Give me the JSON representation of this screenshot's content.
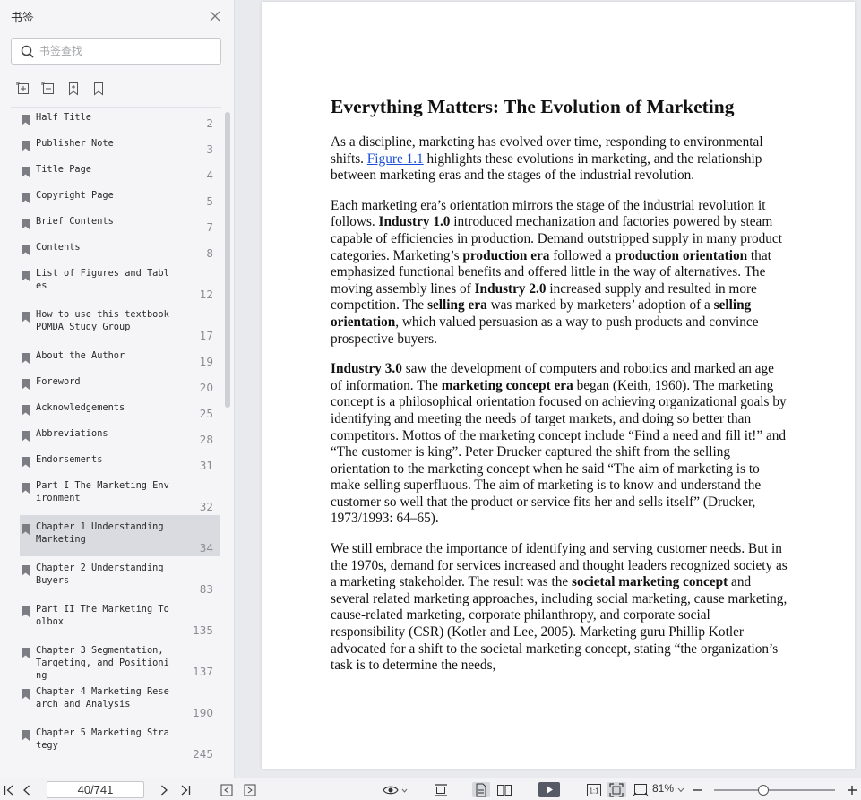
{
  "sidebar": {
    "title": "书签",
    "search_placeholder": "书签查找",
    "bookmarks": [
      {
        "label": "Half Title",
        "page": "2"
      },
      {
        "label": "Publisher Note",
        "page": "3"
      },
      {
        "label": "Title Page",
        "page": "4"
      },
      {
        "label": "Copyright Page",
        "page": "5"
      },
      {
        "label": "Brief Contents",
        "page": "7"
      },
      {
        "label": "Contents",
        "page": "8"
      },
      {
        "label": "List of Figures and Tables",
        "page": "12"
      },
      {
        "label": "How to use this textbook POMDA Study Group",
        "page": "17"
      },
      {
        "label": "About the Author",
        "page": "19"
      },
      {
        "label": "Foreword",
        "page": "20"
      },
      {
        "label": "Acknowledgements",
        "page": "25"
      },
      {
        "label": "Abbreviations",
        "page": "28"
      },
      {
        "label": "Endorsements",
        "page": "31"
      },
      {
        "label": "Part I The Marketing Environment",
        "page": "32"
      },
      {
        "label": "Chapter 1 Understanding Marketing",
        "page": "34",
        "selected": true
      },
      {
        "label": "Chapter 2 Understanding Buyers",
        "page": "83"
      },
      {
        "label": "Part II The Marketing Toolbox",
        "page": "135"
      },
      {
        "label": "Chapter 3 Segmentation, Targeting, and Positioning",
        "page": "137"
      },
      {
        "label": "Chapter 4 Marketing Research and Analysis",
        "page": "190"
      },
      {
        "label": "Chapter 5 Marketing Strategy",
        "page": "245"
      }
    ]
  },
  "document": {
    "heading": "Everything Matters: The Evolution of Marketing",
    "paragraphs": [
      [
        {
          "t": "As a discipline, marketing has evolved over time, responding to environmental shifts. "
        },
        {
          "t": "Figure 1.1",
          "link": true
        },
        {
          "t": " highlights these evolutions in marketing, and the relationship between marketing eras and the stages of the industrial revolution."
        }
      ],
      [
        {
          "t": "Each marketing era’s orientation mirrors the stage of the industrial revolution it follows. "
        },
        {
          "t": "Industry 1.0",
          "b": true
        },
        {
          "t": " introduced mechanization and factories powered by steam capable of efficiencies in production. Demand outstripped supply in many product categories. Marketing’s "
        },
        {
          "t": "production era",
          "b": true
        },
        {
          "t": " followed a "
        },
        {
          "t": "production orientation",
          "b": true
        },
        {
          "t": " that emphasized functional benefits and offered little in the way of alternatives. The moving assembly lines of "
        },
        {
          "t": "Industry 2.0",
          "b": true
        },
        {
          "t": " increased supply and resulted in more competition. The "
        },
        {
          "t": "selling era",
          "b": true
        },
        {
          "t": " was marked by marketers’ adoption of a "
        },
        {
          "t": "selling orientation",
          "b": true
        },
        {
          "t": ", which valued persuasion as a way to push products and convince prospective buyers."
        }
      ],
      [
        {
          "t": "Industry 3.0",
          "b": true
        },
        {
          "t": " saw the development of computers and robotics and marked an age of information. The "
        },
        {
          "t": "marketing concept era",
          "b": true
        },
        {
          "t": " began (Keith, 1960). The marketing concept is a philosophical orientation focused on achieving organizational goals by identifying and meeting the needs of target markets, and doing so better than competitors. Mottos of the marketing concept include “Find a need and fill it!” and “The customer is king”. Peter Drucker captured the shift from the selling orientation to the marketing concept when he said “The aim of marketing is to make selling superfluous. The aim of marketing is to know and understand the customer so well that the product or service fits her and sells itself” (Drucker, 1973/1993: 64–65)."
        }
      ],
      [
        {
          "t": "We still embrace the importance of identifying and serving customer needs. But in the 1970s, demand for services increased and thought leaders recognized society as a marketing stakeholder. The result was the "
        },
        {
          "t": "societal marketing concept",
          "b": true
        },
        {
          "t": " and several related marketing approaches, including social marketing, cause marketing, cause-related marketing, corporate philanthropy, and corporate social responsibility (CSR) (Kotler and Lee, 2005). Marketing guru Phillip Kotler advocated for a shift to the societal marketing concept, stating “the organization’s task is to determine the needs,"
        }
      ]
    ]
  },
  "bottom_bar": {
    "page_indicator": "40/741",
    "zoom": "81%",
    "zoom_level": 0.41
  },
  "colors": {
    "link": "#1a4ed8",
    "sidebar_bg": "#f5f5f7",
    "selected_bg": "#d9dbe0",
    "play_button": "#555a66"
  }
}
